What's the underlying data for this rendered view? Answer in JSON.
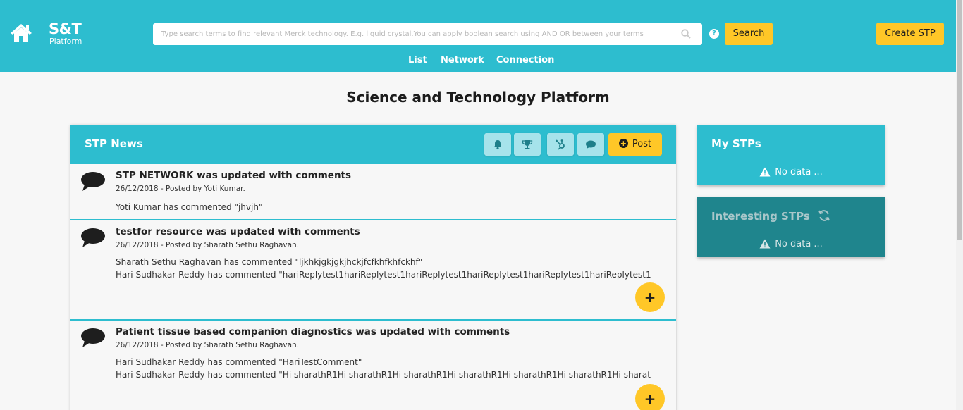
{
  "header": {
    "logo_title": "S&T",
    "logo_subtitle": "Platform",
    "search_placeholder": "Type search terms to find relevant Merck technology. E.g. liquid crystal.You can apply boolean search using AND OR between your terms",
    "search_button": "Search",
    "help_label": "?",
    "create_button": "Create STP",
    "nav": [
      "List",
      "Network",
      "Connection"
    ]
  },
  "page_title": "Science and Technology Platform",
  "news": {
    "title": "STP News",
    "toolbar_icons": [
      "bell-icon",
      "trophy-icon",
      "hubspot-icon",
      "chat-icon"
    ],
    "post_label": "Post",
    "items": [
      {
        "title": "STP NETWORK was updated with comments",
        "meta": "26/12/2018 - Posted by Yoti Kumar.",
        "comments": [
          "Yoti Kumar has commented \"jhvjh\""
        ]
      },
      {
        "title": "testfor resource was updated with comments",
        "meta": "26/12/2018 - Posted by Sharath Sethu Raghavan.",
        "comments": [
          "Sharath Sethu Raghavan has commented \"ljkhkjgkjgkjhckjfcfkhfkhfckhf\"",
          "Hari Sudhakar Reddy has commented \"hariReplytest1hariReplytest1hariReplytest1hariReplytest1hariReplytest1hariReplytest1"
        ]
      },
      {
        "title": "Patient tissue based companion diagnostics was updated with comments",
        "meta": "26/12/2018 - Posted by Sharath Sethu Raghavan.",
        "comments": [
          "Hari Sudhakar Reddy has commented \"HariTestComment\"",
          "Hari Sudhakar Reddy has commented \"Hi sharathR1Hi sharathR1Hi sharathR1Hi sharathR1Hi sharathR1Hi sharathR1Hi sharat"
        ]
      }
    ],
    "fab_label": "+"
  },
  "my_stps": {
    "title": "My STPs",
    "empty": "No data ..."
  },
  "interesting_stps": {
    "title": "Interesting STPs",
    "empty": "No data ..."
  },
  "colors": {
    "primary": "#2dbdcf",
    "accent": "#ffc727",
    "dark_teal": "#1f858d"
  }
}
